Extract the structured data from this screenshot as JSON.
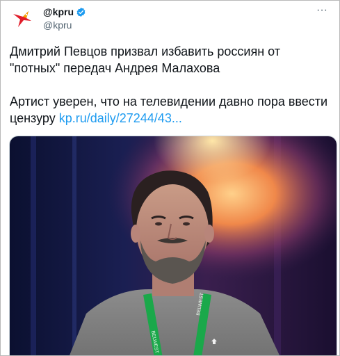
{
  "account": {
    "display_name": "@kpru",
    "handle": "@kpru",
    "avatar_icon": "kp-bird-logo-icon",
    "verified_icon": "verified-badge-icon",
    "brand_color": "#e11d2a",
    "verified_color": "#1d9bf0"
  },
  "menu": {
    "more_label": "···",
    "more_icon": "more-options-icon"
  },
  "tweet": {
    "line1": "Дмитрий Певцов призвал избавить россиян от \"потных\" передач Андрея Малахова",
    "line2_text": "Артист уверен, что на телевидении давно пора ввести цензуру ",
    "link_text": "kp.ru/daily/27244/43...",
    "link_color": "#1d9bf0"
  },
  "media": {
    "lanyard_text": "BELWEST",
    "lanyard_color": "#1aa84a"
  }
}
